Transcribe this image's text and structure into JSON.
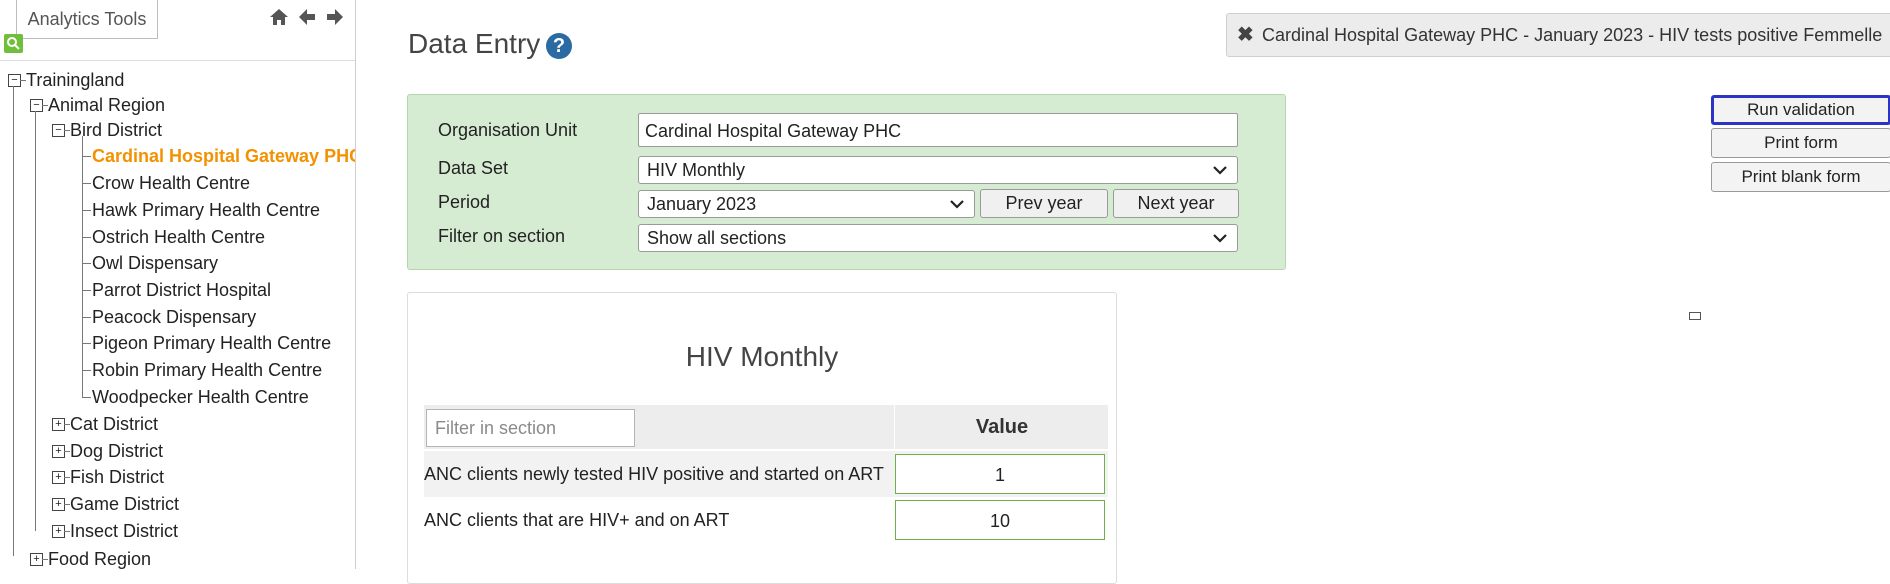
{
  "left": {
    "tab_label": "Analytics Tools",
    "nav_icons": [
      "home-icon",
      "arrow-left-icon",
      "arrow-right-icon"
    ],
    "tree": {
      "root": "Trainingland",
      "region": "Animal Region",
      "district": "Bird District",
      "leaves": [
        "Cardinal Hospital Gateway PHC",
        "Crow Health Centre",
        "Hawk Primary Health Centre",
        "Ostrich Health Centre",
        "Owl Dispensary",
        "Parrot District Hospital",
        "Peacock Dispensary",
        "Pigeon Primary Health Centre",
        "Robin Primary Health Centre",
        "Woodpecker Health Centre"
      ],
      "other_districts": [
        "Cat District",
        "Dog District",
        "Fish District",
        "Game District",
        "Insect District"
      ],
      "other_region": "Food Region"
    }
  },
  "main": {
    "title": "Data Entry",
    "help": "?",
    "criteria": {
      "org_unit_label": "Organisation Unit",
      "org_unit_value": "Cardinal Hospital Gateway PHC",
      "dataset_label": "Data Set",
      "dataset_value": "HIV Monthly",
      "period_label": "Period",
      "period_value": "January 2023",
      "prev_year": "Prev year",
      "next_year": "Next year",
      "filter_label": "Filter on section",
      "filter_value": "Show all sections"
    },
    "form": {
      "title": "HIV Monthly",
      "filter_placeholder": "Filter in section",
      "value_header": "Value",
      "rows": [
        {
          "label": "ANC clients newly tested HIV positive and started on ART",
          "value": "1"
        },
        {
          "label": "ANC clients that are HIV+ and on ART",
          "value": "10"
        }
      ]
    }
  },
  "right": {
    "notification": "Cardinal Hospital Gateway PHC - January 2023 - HIV tests positive Femmelle",
    "run_validation": "Run validation",
    "print_form": "Print form",
    "print_blank_form": "Print blank form"
  },
  "colors": {
    "selected": "#f39200",
    "criteria_bg": "#d6ecd2",
    "validation_border": "#2b34c5"
  }
}
